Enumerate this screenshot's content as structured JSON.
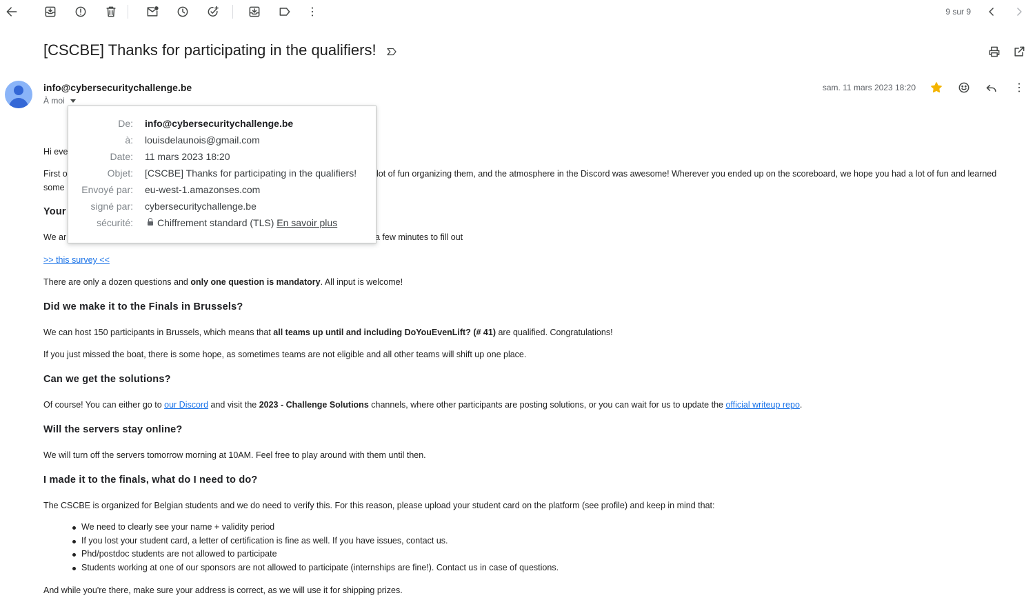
{
  "toolbar": {
    "icons": [
      "back-arrow-icon",
      "archive-icon",
      "report-spam-icon",
      "delete-icon",
      "mark-unread-icon",
      "snooze-icon",
      "add-task-icon",
      "move-to-icon",
      "label-icon",
      "more-vert-icon"
    ],
    "pager": "9 sur 9"
  },
  "email": {
    "subject": "[CSCBE] Thanks for participating in the qualifiers!",
    "sender": "info@cybersecuritychallenge.be",
    "to_label": "À moi",
    "date": "sam. 11 mars 2023 18:20"
  },
  "details_popup": {
    "rows": [
      {
        "label": "De:",
        "value": "info@cybersecuritychallenge.be"
      },
      {
        "label": "à:",
        "value": "louisdelaunois@gmail.com"
      },
      {
        "label": "Date:",
        "value": "11 mars 2023 18:20"
      },
      {
        "label": "Objet:",
        "value": "[CSCBE] Thanks for participating in the qualifiers!"
      },
      {
        "label": "Envoyé par:",
        "value": "eu-west-1.amazonses.com"
      },
      {
        "label": "signé par:",
        "value": "cybersecuritychallenge.be"
      },
      {
        "label": "sécurité:",
        "value": "Chiffrement standard (TLS)"
      }
    ],
    "learn_more": "En savoir plus"
  },
  "body": {
    "greeting": "Hi eve",
    "intro_1a": "First o",
    "intro_1b": "lot of fun organizing them, and the atmosphere in the Discord was awesome! Wherever you ended up on the scoreboard, we hope you had a lot of fun and learned",
    "intro_2": "some",
    "heading_feedback": "Your",
    "survey_1a": "We ar",
    "survey_1b": "a few minutes to fill out",
    "survey_link": ">> this survey <<",
    "dozen_a": "There are only a dozen questions and ",
    "dozen_b": "only one question is mandatory",
    "dozen_c": ". All input is welcome!",
    "heading_finals": "Did we make it to the Finals in Brussels?",
    "host_a": "We can host 150 participants in Brussels, which means that ",
    "host_b": "all teams up until and including DoYouEvenLift? (# 41)",
    "host_c": " are qualified. Congratulations!",
    "missed": "If you just missed the boat, there is some hope, as sometimes teams are not eligible and all other teams will shift up one place.",
    "heading_solutions": "Can we get the solutions?",
    "sol_a": "Of course! You can either go to ",
    "sol_link1": "our Discord",
    "sol_b": " and visit the ",
    "sol_bold": "2023 - Challenge Solutions",
    "sol_c": " channels, where other participants are posting solutions, or you can wait for us to update the ",
    "sol_link2": "official writeup repo",
    "sol_d": ".",
    "heading_servers": "Will the servers stay online?",
    "servers": "We will turn off the servers tomorrow morning at 10AM. Feel free to play around with them until then.",
    "heading_todo": "I made it to the finals, what do I need to do?",
    "todo": "The CSCBE is organized for Belgian students and we do need to verify this. For this reason, please upload your student card on the platform (see profile) and keep in mind that:",
    "bullets": [
      "We need to clearly see your name + validity period",
      "If you lost your student card, a letter of certification is fine as well. If you have issues, contact us.",
      "Phd/postdoc students are not allowed to participate",
      "Students working at one of our sponsors are not allowed to participate (internships are fine!). Contact us in case of questions."
    ],
    "address": "And while you're there, make sure your address is correct, as we will use it for shipping prizes."
  }
}
